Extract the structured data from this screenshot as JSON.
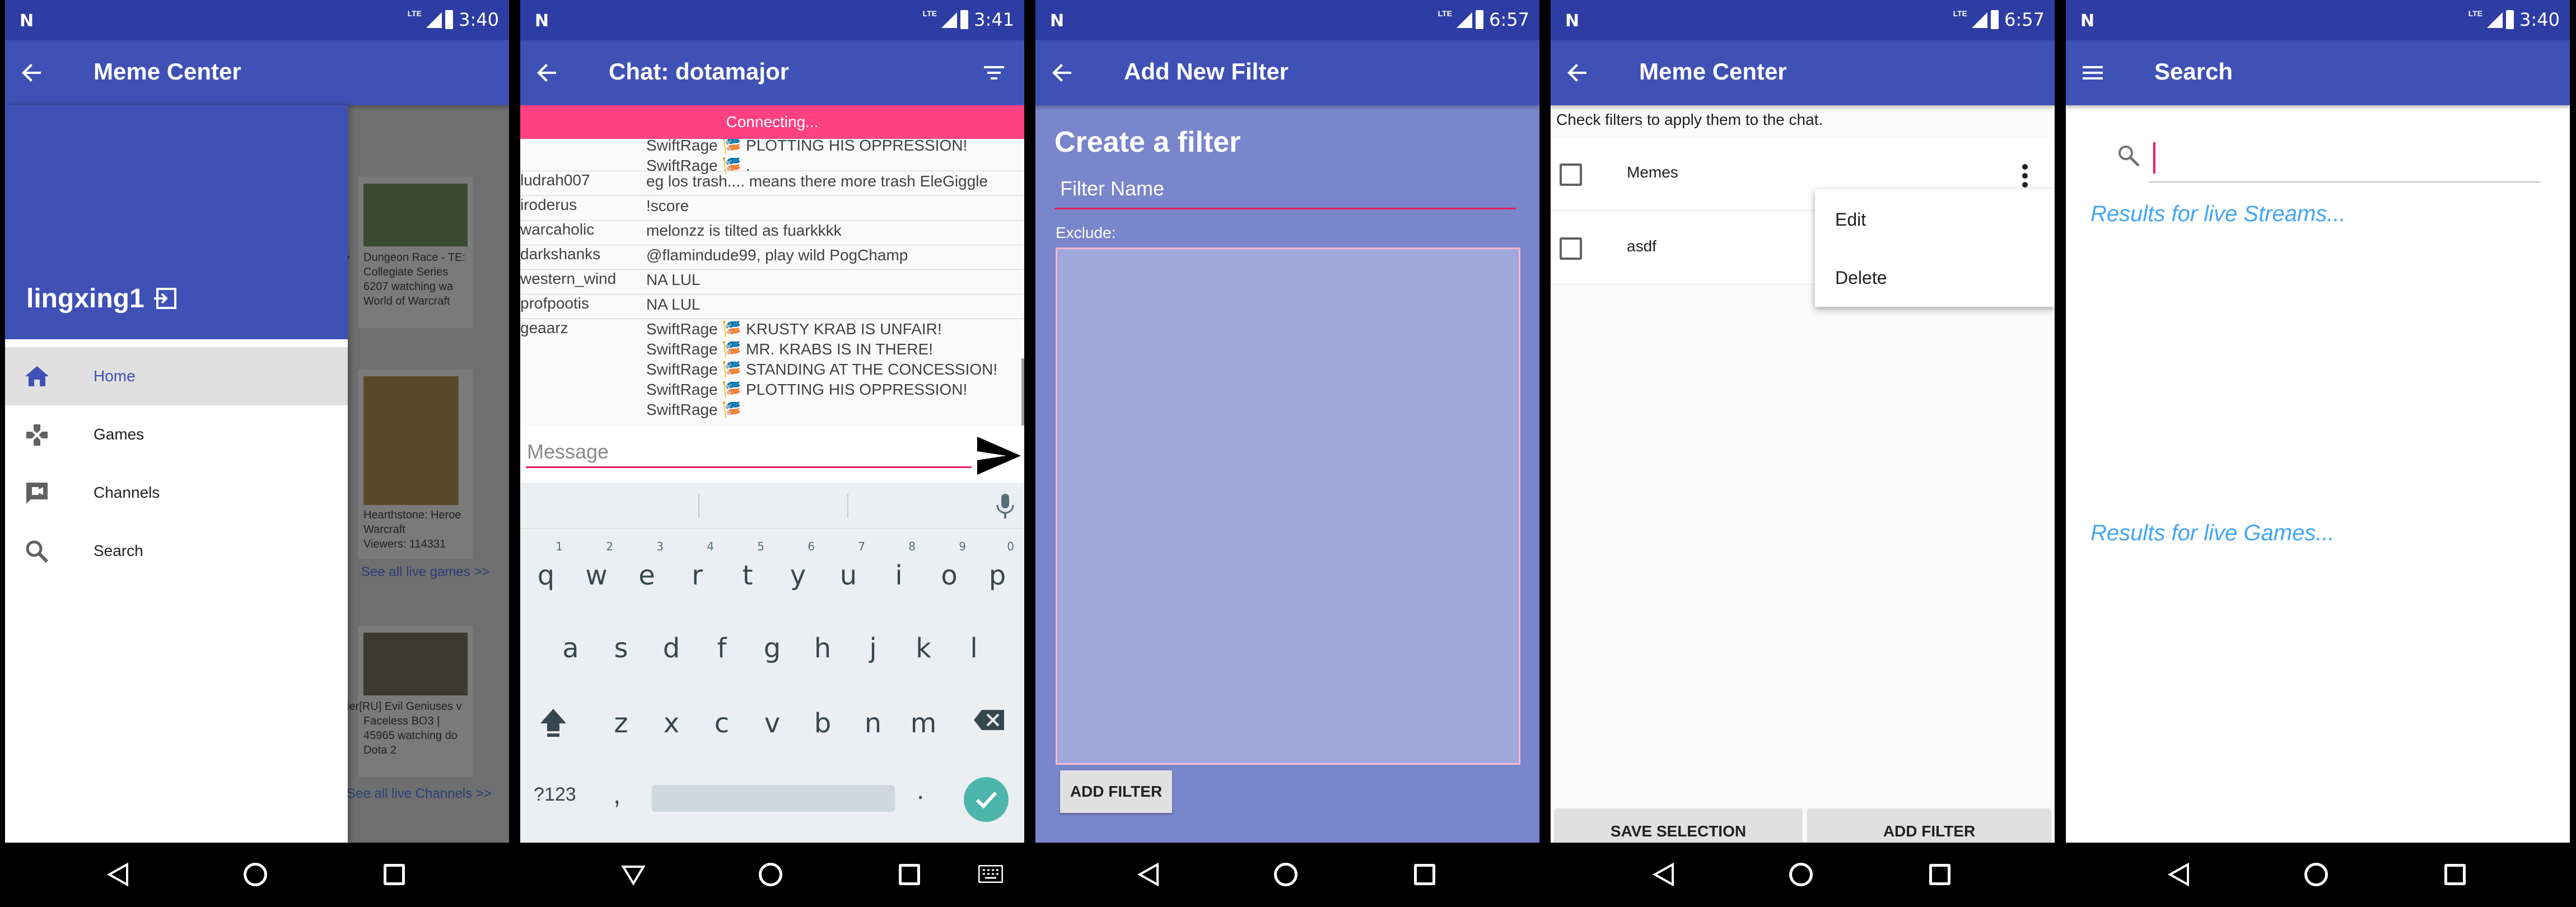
{
  "status_bars": [
    {
      "time": "3:40",
      "network": "LTE"
    },
    {
      "time": "3:41",
      "network": "LTE"
    },
    {
      "time": "6:57",
      "network": "LTE"
    },
    {
      "time": "6:57",
      "network": "LTE"
    },
    {
      "time": "3:40",
      "network": "LTE"
    }
  ],
  "screen1": {
    "title": "Meme Center",
    "username": "lingxing1",
    "drawer_items": [
      {
        "label": "Home",
        "icon": "home-icon",
        "active": true
      },
      {
        "label": "Games",
        "icon": "gamepad-icon",
        "active": false
      },
      {
        "label": "Channels",
        "icon": "video-chat-icon",
        "active": false
      },
      {
        "label": "Search",
        "icon": "search-icon",
        "active": false
      }
    ],
    "bg_cards": [
      {
        "lines": [
          "Dungeon Race - TE:",
          "Collegiate Series",
          "6207 watching wa",
          "World of Warcraft"
        ]
      },
      {
        "lines": [
          "Hearthstone: Heroe",
          "Warcraft",
          "Viewers: 114331"
        ]
      },
      {
        "lines": [
          "ier[RU] Evil Geniuses v",
          "Faceless BO3 |",
          "45965 watching do",
          "Dota 2"
        ]
      }
    ],
    "bg_links": [
      "See all live games >>",
      "See all live Channels >>"
    ],
    "bg_prefix": "y"
  },
  "screen2": {
    "title": "Chat: dotamajor",
    "banner": "Connecting...",
    "messages": [
      {
        "user": "",
        "lines": [
          "SwiftRage 🎏 PLOTTING HIS OPPRESSION!",
          "SwiftRage 🎏 ."
        ]
      },
      {
        "user": "ludrah007",
        "lines": [
          "eg los trash.... means there more trash EleGiggle"
        ]
      },
      {
        "user": "iroderus",
        "lines": [
          "!score"
        ]
      },
      {
        "user": "warcaholic",
        "lines": [
          "melonzz is tilted as fuarkkkk"
        ]
      },
      {
        "user": "darkshanks",
        "lines": [
          "@flamindude99, play wild PogChamp"
        ]
      },
      {
        "user": "western_wind",
        "lines": [
          "NA LUL"
        ]
      },
      {
        "user": "profpootis",
        "lines": [
          "NA LUL"
        ]
      },
      {
        "user": "geaarz",
        "lines": [
          "SwiftRage 🎏 KRUSTY KRAB IS UNFAIR!",
          "SwiftRage 🎏 MR. KRABS IS IN THERE!",
          "SwiftRage 🎏 STANDING AT THE CONCESSION!",
          "SwiftRage 🎏 PLOTTING HIS OPPRESSION!",
          "SwiftRage 🎏"
        ]
      }
    ],
    "message_placeholder": "Message",
    "keyboard": {
      "row1": [
        [
          "q",
          "1"
        ],
        [
          "w",
          "2"
        ],
        [
          "e",
          "3"
        ],
        [
          "r",
          "4"
        ],
        [
          "t",
          "5"
        ],
        [
          "y",
          "6"
        ],
        [
          "u",
          "7"
        ],
        [
          "i",
          "8"
        ],
        [
          "o",
          "9"
        ],
        [
          "p",
          "0"
        ]
      ],
      "row2": [
        "a",
        "s",
        "d",
        "f",
        "g",
        "h",
        "j",
        "k",
        "l"
      ],
      "row3": [
        "z",
        "x",
        "c",
        "v",
        "b",
        "n",
        "m"
      ],
      "sym_label": "?123",
      "comma": ",",
      "period": "."
    }
  },
  "screen3": {
    "title": "Add New Filter",
    "heading": "Create a filter",
    "filter_name_placeholder": "Filter Name",
    "exclude_label": "Exclude:",
    "add_button": "ADD FILTER"
  },
  "screen4": {
    "title": "Meme Center",
    "hint": "Check filters to apply them to the chat.",
    "filters": [
      {
        "label": "Memes",
        "checked": false
      },
      {
        "label": "asdf",
        "checked": false
      }
    ],
    "popup_items": [
      "Edit",
      "Delete"
    ],
    "save_button": "SAVE SELECTION",
    "add_button": "ADD FILTER"
  },
  "screen5": {
    "title": "Search",
    "search_value": "",
    "results_streams": "Results for live Streams...",
    "results_games": "Results for live Games..."
  },
  "colors": {
    "primary": "#3f51b5",
    "primary_dark": "#2d3da4",
    "accent": "#ff4081",
    "link": "#42a5f5"
  }
}
